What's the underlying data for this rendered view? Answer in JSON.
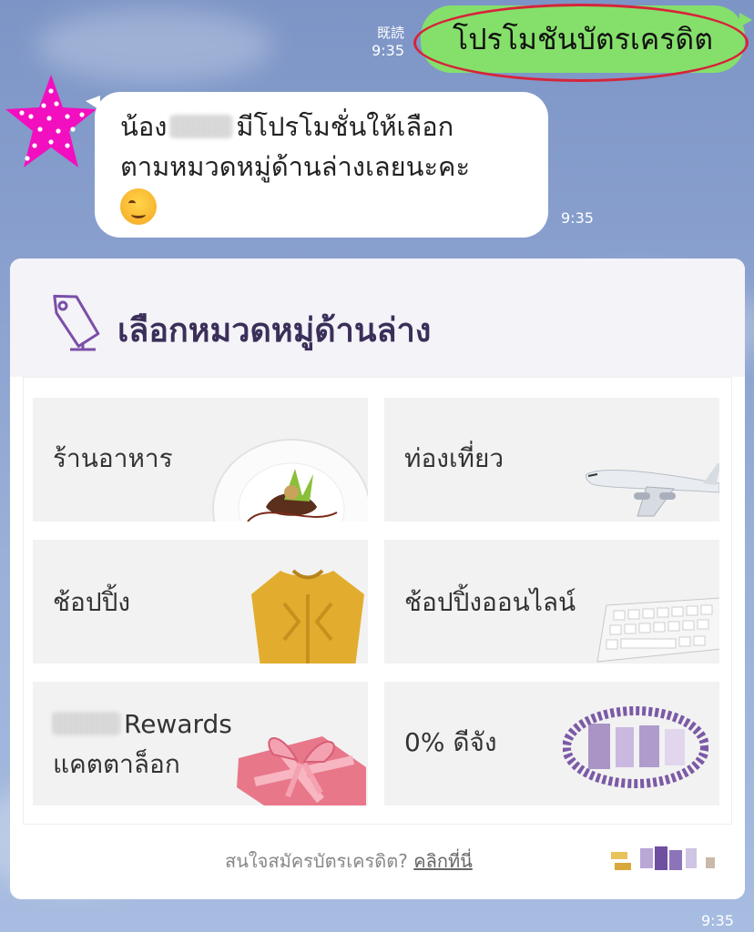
{
  "outgoing": {
    "read_label": "既読",
    "time": "9:35",
    "text": "โปรโมชันบัตรเครดิต"
  },
  "incoming": {
    "line1_prefix": "น้อง",
    "line1_suffix": "มีโปรโมชั่นให้เลือก",
    "line2": "ตามหมวดหมู่ด้านล่างเลยนะคะ",
    "emoji_icon": "winking-face-icon",
    "time": "9:35"
  },
  "card": {
    "title": "เลือกหมวดหมู่ด้านล่าง",
    "title_icon": "price-tag-icon",
    "categories": [
      {
        "label": "ร้านอาหาร",
        "image": "food-plate-icon"
      },
      {
        "label": "ท่องเที่ยว",
        "image": "airplane-icon"
      },
      {
        "label": "ช้อปปิ้ง",
        "image": "sweater-icon"
      },
      {
        "label": "ช้อปปิ้งออนไลน์",
        "image": "keyboard-icon"
      },
      {
        "label_line1": "Rewards",
        "label_line2": "แคตตาล็อก",
        "image": "gift-box-icon"
      },
      {
        "label": "0% ดีจัง",
        "image": "blurred-logo-icon"
      }
    ],
    "footer_question": "สนใจสมัครบัตรเครดิต?",
    "footer_link": "คลิกที่นี่",
    "footer_brand_icon": "blurred-brand-icon",
    "time": "9:35"
  },
  "colors": {
    "outgoing_bubble": "#85e06b",
    "highlight_ring": "#d6243a",
    "avatar_star": "#f20fbf",
    "card_title": "#3b2f5a"
  }
}
